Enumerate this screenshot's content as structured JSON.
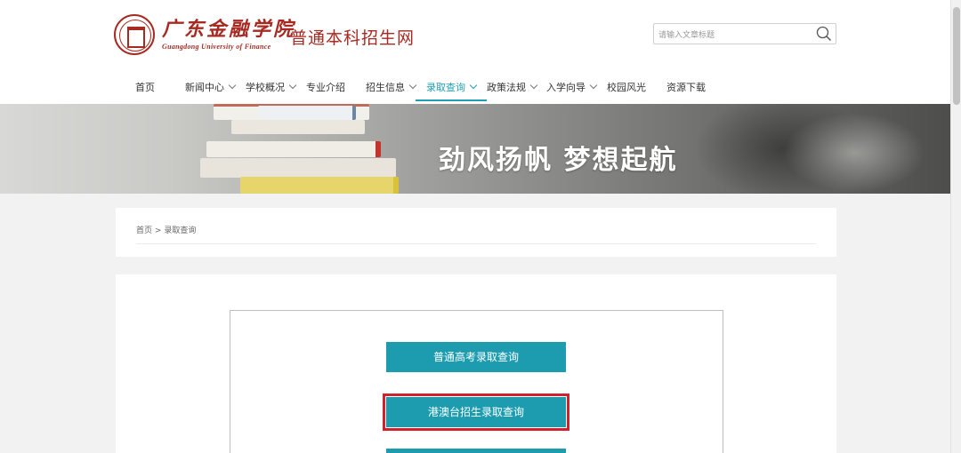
{
  "header": {
    "logo_cn": "广东金融学院",
    "logo_en": "Guangdong University of Finance",
    "site_title": "普通本科招生网"
  },
  "search": {
    "placeholder": "请输入文章标题",
    "icon": "search-icon"
  },
  "nav": {
    "items": [
      {
        "label": "首页",
        "has_dropdown": false,
        "active": false
      },
      {
        "label": "新闻中心",
        "has_dropdown": true,
        "active": false
      },
      {
        "label": "学校概况",
        "has_dropdown": true,
        "active": false
      },
      {
        "label": "专业介绍",
        "has_dropdown": false,
        "active": false
      },
      {
        "label": "招生信息",
        "has_dropdown": true,
        "active": false
      },
      {
        "label": "录取查询",
        "has_dropdown": true,
        "active": true
      },
      {
        "label": "政策法规",
        "has_dropdown": true,
        "active": false
      },
      {
        "label": "入学向导",
        "has_dropdown": true,
        "active": false
      },
      {
        "label": "校园风光",
        "has_dropdown": false,
        "active": false
      },
      {
        "label": "资源下载",
        "has_dropdown": false,
        "active": false
      }
    ],
    "active_color": "#1f9fb3"
  },
  "banner": {
    "slogan": "劲风扬帆   梦想起航"
  },
  "breadcrumb": {
    "home": "首页",
    "separator": ">",
    "current": "录取查询"
  },
  "query_buttons": [
    {
      "label": "普通高考录取查询",
      "highlighted": false
    },
    {
      "label": "港澳台招生录取查询",
      "highlighted": true
    },
    {
      "label": "",
      "highlighted": false
    }
  ],
  "colors": {
    "brand": "#a72a22",
    "accent": "#1d9cb0",
    "highlight": "#d0222e"
  }
}
